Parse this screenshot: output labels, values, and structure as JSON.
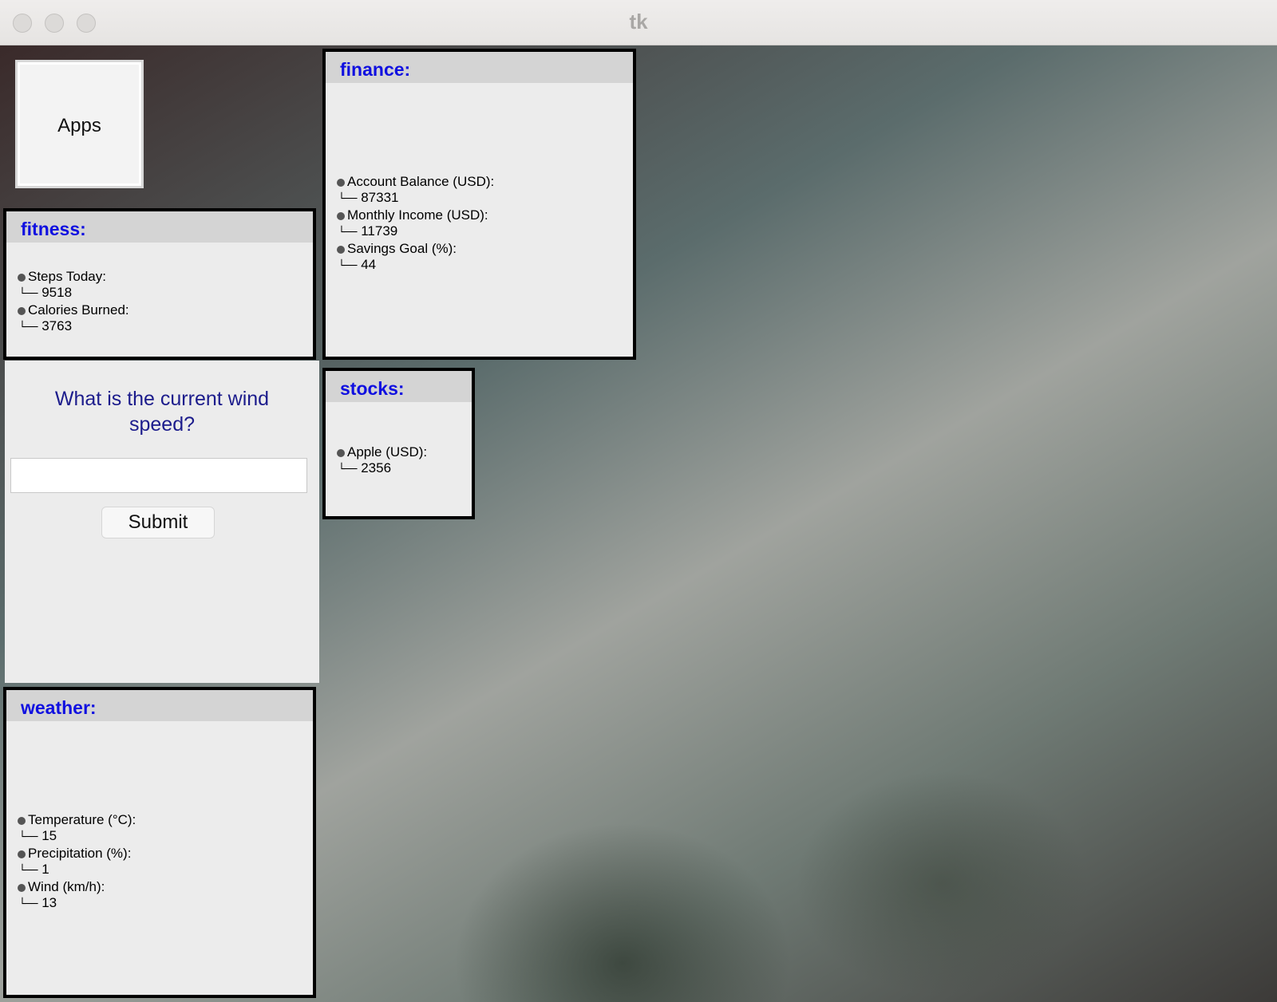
{
  "window": {
    "title": "tk"
  },
  "apps_button": {
    "label": "Apps"
  },
  "fitness": {
    "title": "fitness:",
    "items": [
      {
        "label": "Steps Today:",
        "value": "9518"
      },
      {
        "label": "Calories Burned:",
        "value": "3763"
      }
    ]
  },
  "finance": {
    "title": "finance:",
    "items": [
      {
        "label": "Account Balance (USD):",
        "value": "87331"
      },
      {
        "label": "Monthly Income (USD):",
        "value": "11739"
      },
      {
        "label": "Savings Goal (%):",
        "value": "44"
      }
    ]
  },
  "stocks": {
    "title": "stocks:",
    "items": [
      {
        "label": "Apple (USD):",
        "value": "2356"
      }
    ]
  },
  "weather": {
    "title": "weather:",
    "items": [
      {
        "label": "Temperature (°C):",
        "value": "15"
      },
      {
        "label": "Precipitation (%):",
        "value": "1"
      },
      {
        "label": "Wind (km/h):",
        "value": "13"
      }
    ]
  },
  "question": {
    "text": "What is the current wind speed?",
    "answer_value": "",
    "submit_label": "Submit"
  },
  "branch_glyph": "└──"
}
